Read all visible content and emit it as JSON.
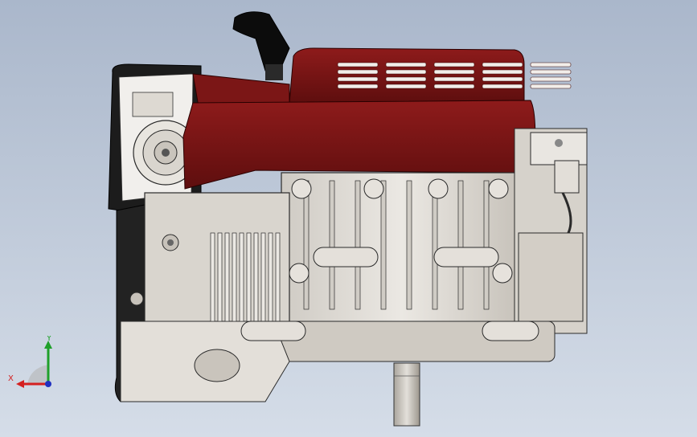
{
  "viewport": {
    "background_top": "#aab7cb",
    "background_bottom": "#d5dde8"
  },
  "model": {
    "subject": "engine-assembly",
    "shroud_color": "#7a1414",
    "body_color": "#dcd8d2",
    "edge_color": "#2a2a2a"
  },
  "triad": {
    "x_label": "X",
    "y_label": "Y",
    "x_color": "#d42020",
    "y_color": "#1fa02a",
    "z_color": "#2030c0"
  }
}
